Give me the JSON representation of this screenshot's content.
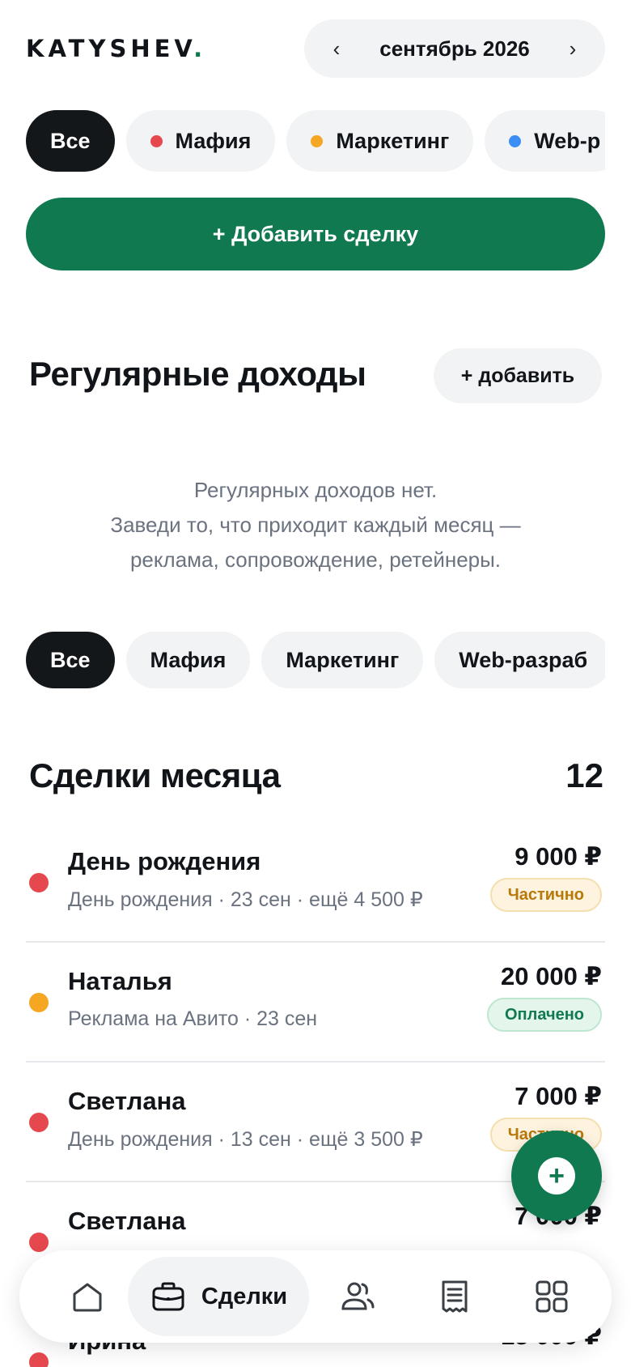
{
  "header": {
    "logo_text": "KATYSHEV",
    "logo_dot": ".",
    "month_label": "сентябрь 2026",
    "prev_label": "‹",
    "next_label": "›"
  },
  "colors": {
    "accent": "#11794f",
    "mafia": "#e5484d",
    "marketing": "#f5a623",
    "web": "#3b8ef5",
    "chip_bg": "#f1f3f5",
    "active_chip_bg": "#14171a"
  },
  "top_filters": [
    {
      "label": "Все",
      "active": true
    },
    {
      "label": "Мафия",
      "dot": "#e5484d"
    },
    {
      "label": "Маркетинг",
      "dot": "#f5a623"
    },
    {
      "label": "Web-р",
      "dot": "#3b8ef5"
    }
  ],
  "add_deal_label": "+ Добавить сделку",
  "recurring": {
    "title": "Регулярные доходы",
    "add_label": "+ добавить",
    "empty_lines": [
      "Регулярных доходов нет.",
      "Заведи то, что приходит каждый месяц —",
      "реклама, сопровождение, ретейнеры."
    ]
  },
  "bottom_filters": [
    {
      "label": "Все",
      "active": true
    },
    {
      "label": "Мафия"
    },
    {
      "label": "Маркетинг"
    },
    {
      "label": "Web-разраб"
    }
  ],
  "deals": {
    "title": "Сделки месяца",
    "count": "12",
    "items": [
      {
        "name": "День рождения",
        "sub": "День рождения · 23 сен · ещё 4 500 ₽",
        "amount": "9 000 ₽",
        "status": "Частично",
        "status_kind": "partial",
        "dot": "#e5484d"
      },
      {
        "name": "Наталья",
        "sub": "Реклама на Авито · 23 сен",
        "amount": "20 000 ₽",
        "status": "Оплачено",
        "status_kind": "paid",
        "dot": "#f5a623"
      },
      {
        "name": "Светлана",
        "sub": "День рождения · 13 сен · ещё 3 500 ₽",
        "amount": "7 000 ₽",
        "status": "Частично",
        "status_kind": "partial",
        "dot": "#e5484d"
      },
      {
        "name": "Светлана",
        "sub": "",
        "amount": "7 000 ₽",
        "status": "",
        "status_kind": "partial",
        "dot": "#e5484d"
      },
      {
        "name": "Ирина",
        "sub": "",
        "amount": "15 000 ₽",
        "status": "",
        "status_kind": "paid",
        "dot": "#e5484d"
      }
    ]
  },
  "fab_icon": "plus-icon",
  "tabbar": {
    "items": [
      {
        "icon": "home-icon"
      },
      {
        "icon": "briefcase-icon",
        "label": "Сделки",
        "active": true
      },
      {
        "icon": "users-icon"
      },
      {
        "icon": "receipt-icon"
      },
      {
        "icon": "grid-icon"
      }
    ]
  }
}
